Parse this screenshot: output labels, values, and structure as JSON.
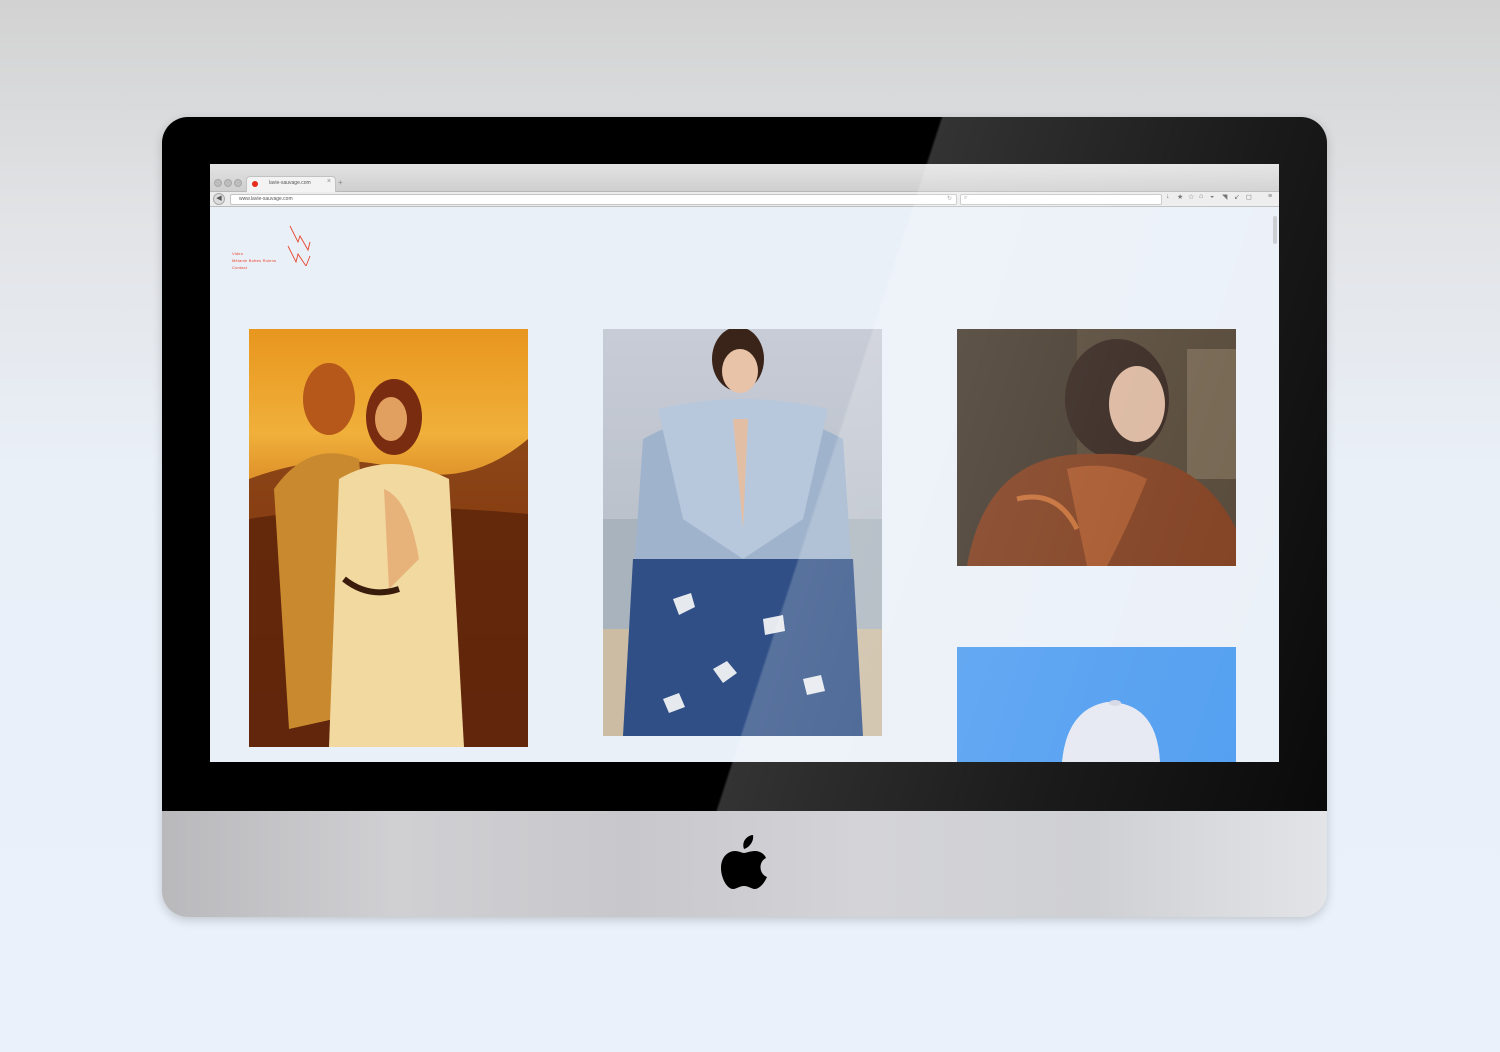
{
  "browser": {
    "tab_title": "lavie-sauvage.com",
    "tab_close": "×",
    "new_tab": "+",
    "back": "◀",
    "url": "www.lavie-sauvage.com"
  },
  "site": {
    "nav": [
      "Video",
      "Mélanie Bottes Rulens",
      "Contact"
    ]
  },
  "colors": {
    "accent": "#e8452e",
    "page_bg": "#eaf0f8",
    "bezel": "#000000"
  },
  "icons": [
    "apple-logo",
    "back-arrow-icon",
    "reload-icon",
    "search-icon",
    "download-icon",
    "bookmark-icon",
    "star-icon",
    "home-icon",
    "pocket-icon",
    "menu-icon"
  ]
}
